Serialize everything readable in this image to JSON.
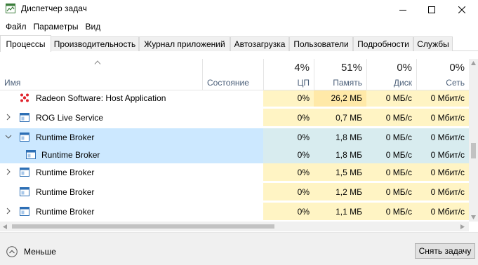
{
  "window": {
    "title": "Диспетчер задач",
    "minimize_glyph": "–",
    "maximize_glyph": "☐",
    "close_glyph": "✕"
  },
  "menu": [
    "Файл",
    "Параметры",
    "Вид"
  ],
  "tabs": [
    {
      "label": "Процессы",
      "active": true
    },
    {
      "label": "Производительность",
      "active": false
    },
    {
      "label": "Журнал приложений",
      "active": false
    },
    {
      "label": "Автозагрузка",
      "active": false
    },
    {
      "label": "Пользователи",
      "active": false
    },
    {
      "label": "Подробности",
      "active": false
    },
    {
      "label": "Службы",
      "active": false
    }
  ],
  "columns": {
    "name": "Имя",
    "status": "Состояние",
    "cpu": {
      "label": "ЦП",
      "total": "4%"
    },
    "memory": {
      "label": "Память",
      "total": "51%"
    },
    "disk": {
      "label": "Диск",
      "total": "0%"
    },
    "network": {
      "label": "Сеть",
      "total": "0%"
    }
  },
  "rows": [
    {
      "name": "Radeon Software: Host Application",
      "icon": "radeon-icon",
      "expandable": false,
      "cpu": "0%",
      "memory": "26,2 МБ",
      "disk": "0 МБ/с",
      "network": "0 Мбит/с"
    },
    {
      "name": "ROG Live Service",
      "icon": "window-icon",
      "expandable": true,
      "cpu": "0%",
      "memory": "0,7 МБ",
      "disk": "0 МБ/с",
      "network": "0 Мбит/с"
    },
    {
      "name": "Runtime Broker",
      "icon": "window-icon",
      "expandable": true,
      "expanded": true,
      "selected": true,
      "cpu": "0%",
      "memory": "1,8 МБ",
      "disk": "0 МБ/с",
      "network": "0 Мбит/с"
    },
    {
      "name": "Runtime Broker",
      "icon": "window-icon",
      "child": true,
      "selected": true,
      "cpu": "0%",
      "memory": "1,8 МБ",
      "disk": "0 МБ/с",
      "network": "0 Мбит/с"
    },
    {
      "name": "Runtime Broker",
      "icon": "window-icon",
      "expandable": true,
      "cpu": "0%",
      "memory": "1,5 МБ",
      "disk": "0 МБ/с",
      "network": "0 Мбит/с"
    },
    {
      "name": "Runtime Broker",
      "icon": "window-icon",
      "expandable": false,
      "cpu": "0%",
      "memory": "1,2 МБ",
      "disk": "0 МБ/с",
      "network": "0 Мбит/с"
    },
    {
      "name": "Runtime Broker",
      "icon": "window-icon",
      "expandable": true,
      "cpu": "0%",
      "memory": "1,1 МБ",
      "disk": "0 МБ/с",
      "network": "0 Мбит/с"
    }
  ],
  "footer": {
    "less_label": "Меньше",
    "end_task_label": "Снять задачу"
  },
  "colors": {
    "selection": "#cce8ff",
    "heat": "#fff4c4",
    "header_label": "#4c607a",
    "radeon_red": "#e0232c"
  }
}
